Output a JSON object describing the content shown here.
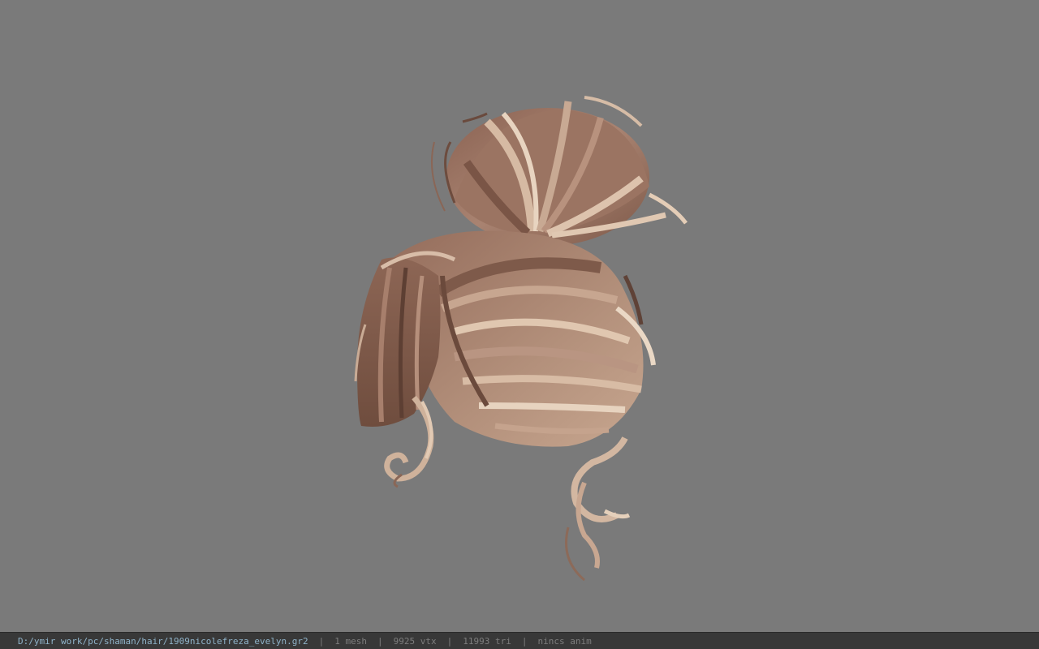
{
  "viewport": {
    "background": "#7a7a7a",
    "model_name": "hair-mesh",
    "hair_colors": {
      "dark": "#7a5645",
      "mid": "#9c7563",
      "light": "#c9ab93",
      "highlight": "#e3cdb6"
    }
  },
  "statusbar": {
    "file_path": "D:/ymir work/pc/shaman/hair/1909nicolefreza_evelyn.gr2",
    "separator": "|",
    "mesh_count": "1 mesh",
    "vertex_count": "9925 vtx",
    "triangle_count": "11993 tri",
    "anim_status": "nincs anim"
  }
}
